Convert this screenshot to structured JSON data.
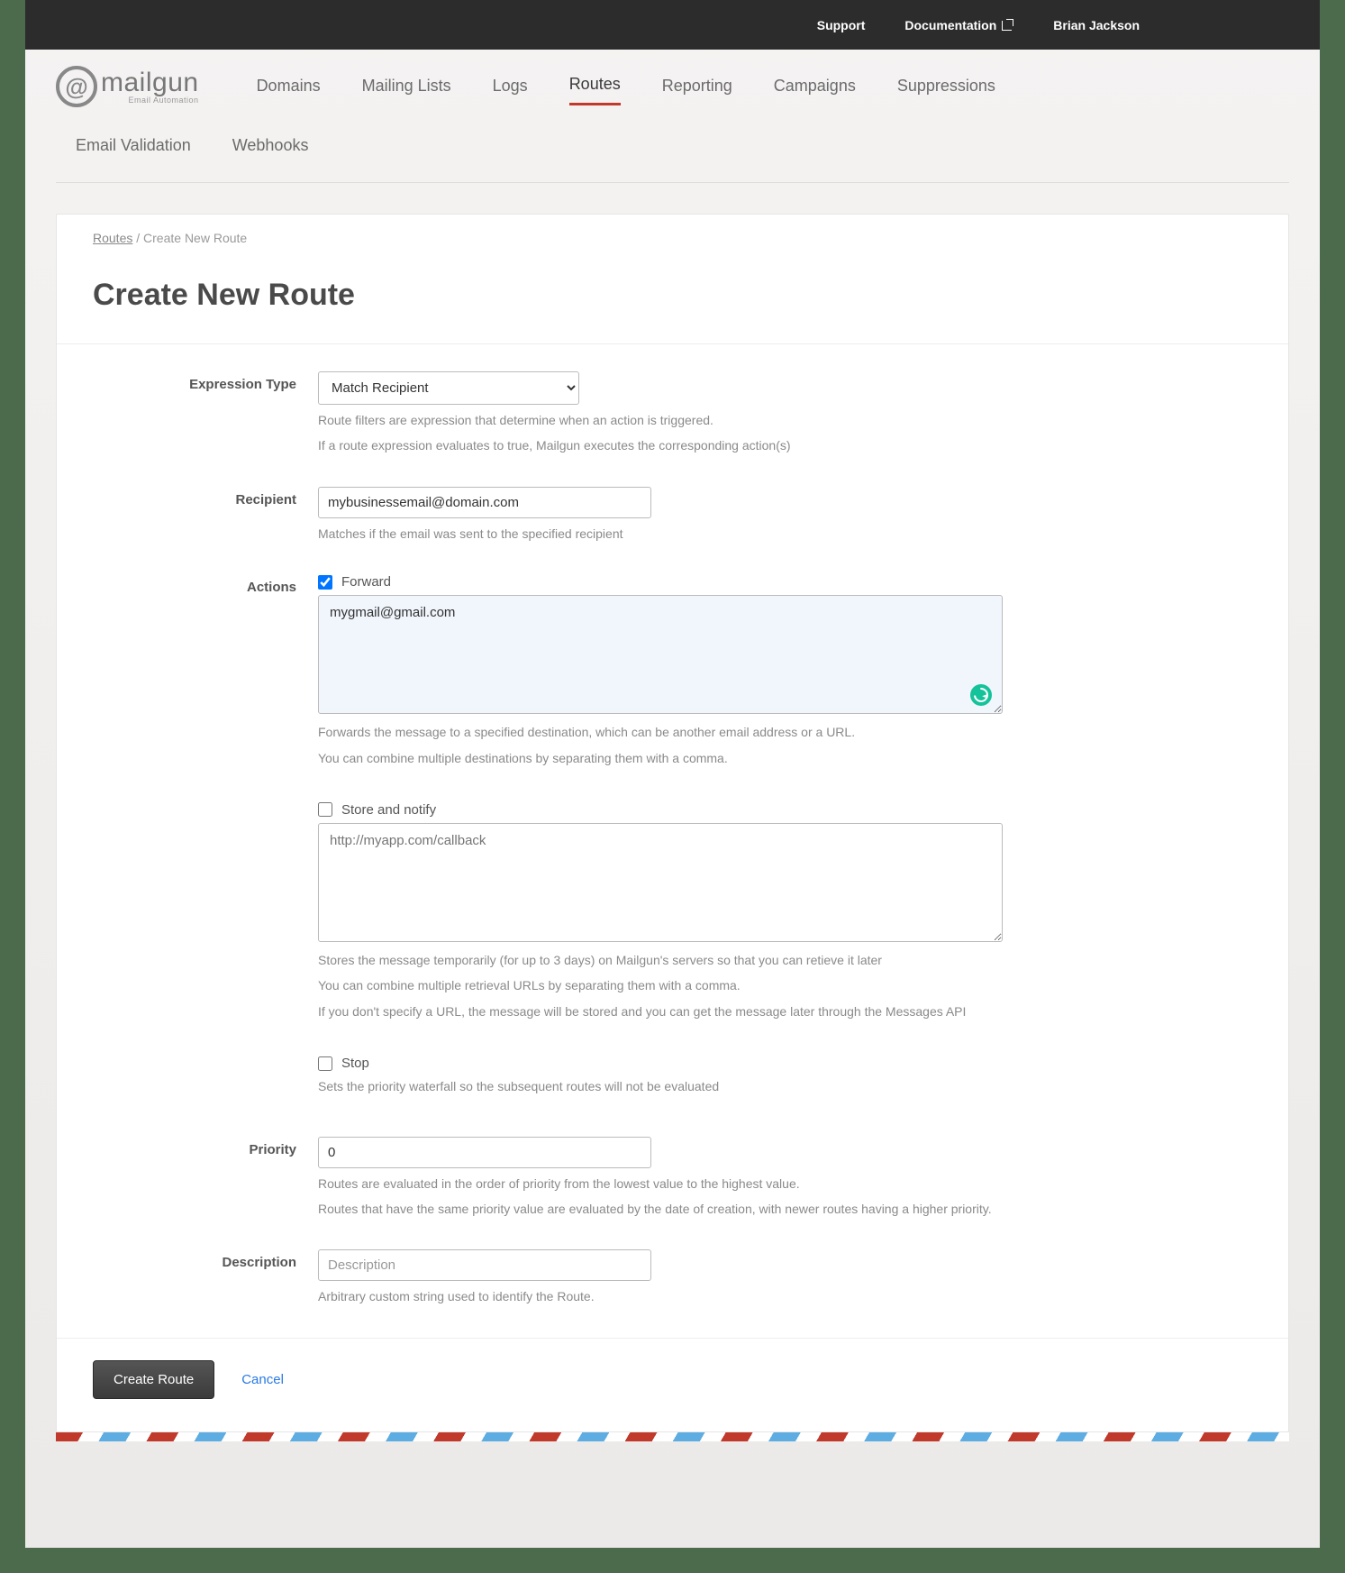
{
  "topbar": {
    "support": "Support",
    "documentation": "Documentation",
    "user": "Brian Jackson"
  },
  "logo": {
    "name": "mailgun",
    "tagline": "Email Automation"
  },
  "nav": {
    "row1": [
      "Domains",
      "Mailing Lists",
      "Logs",
      "Routes",
      "Reporting",
      "Campaigns",
      "Suppressions"
    ],
    "row2": [
      "Email Validation",
      "Webhooks"
    ],
    "active": "Routes"
  },
  "breadcrumb": {
    "parent": "Routes",
    "current": "Create New Route"
  },
  "page_title": "Create New Route",
  "form": {
    "expression_type": {
      "label": "Expression Type",
      "value": "Match Recipient",
      "help1": "Route filters are expression that determine when an action is triggered.",
      "help2": "If a route expression evaluates to true, Mailgun executes the corresponding action(s)"
    },
    "recipient": {
      "label": "Recipient",
      "value": "mybusinessemail@domain.com",
      "help": "Matches if the email was sent to the specified recipient"
    },
    "actions_label": "Actions",
    "forward": {
      "checked": true,
      "label": "Forward",
      "value": "mygmail@gmail.com",
      "help1": "Forwards the message to a specified destination, which can be another email address or a URL.",
      "help2": "You can combine multiple destinations by separating them with a comma."
    },
    "store": {
      "checked": false,
      "label": "Store and notify",
      "placeholder": "http://myapp.com/callback",
      "value": "",
      "help1": "Stores the message temporarily (for up to 3 days) on Mailgun's servers so that you can retieve it later",
      "help2": "You can combine multiple retrieval URLs by separating them with a comma.",
      "help3": "If you don't specify a URL, the message will be stored and you can get the message later through the Messages API"
    },
    "stop": {
      "checked": false,
      "label": "Stop",
      "help": "Sets the priority waterfall so the subsequent routes will not be evaluated"
    },
    "priority": {
      "label": "Priority",
      "value": "0",
      "help1": "Routes are evaluated in the order of priority from the lowest value to the highest value.",
      "help2": "Routes that have the same priority value are evaluated by the date of creation, with newer routes having a higher priority."
    },
    "description": {
      "label": "Description",
      "placeholder": "Description",
      "value": "",
      "help": "Arbitrary custom string used to identify the Route."
    }
  },
  "footer": {
    "submit": "Create Route",
    "cancel": "Cancel"
  }
}
